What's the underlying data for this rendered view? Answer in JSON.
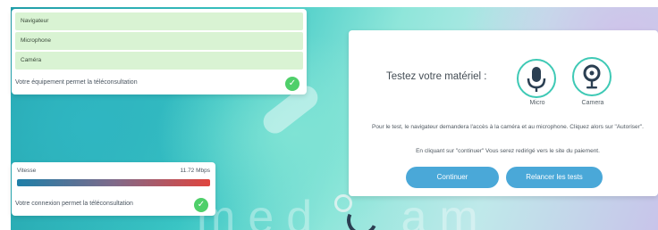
{
  "devices_card": {
    "items": [
      "Navigateur",
      "Microphone",
      "Caméra"
    ],
    "status": "Votre équipement permet la téléconsultation"
  },
  "speed_card": {
    "label": "Vitesse",
    "value": "11.72 Mbps",
    "status": "Votre connexion permet la téléconsultation"
  },
  "test_card": {
    "title": "Testez votre matériel :",
    "micro_label": "Micro",
    "camera_label": "Camera",
    "info_1": "Pour le test, le navigateur demandera l'accès à la caméra et au microphone. Cliquez alors sur \"Autoriser\".",
    "info_2": "En cliquant sur \"continuer\" Vous serez redirigé vers le site du paiement.",
    "continue_label": "Continuer",
    "retry_label": "Relancer les tests"
  },
  "brand": {
    "text": "medicam"
  },
  "colors": {
    "accent_teal": "#3ec9b5",
    "button_blue": "#4aa8d8",
    "ok_green": "#4fcf6a",
    "device_row_green": "#d9f3d3"
  },
  "icons": [
    "microphone-icon",
    "camera-icon",
    "check-icon"
  ]
}
